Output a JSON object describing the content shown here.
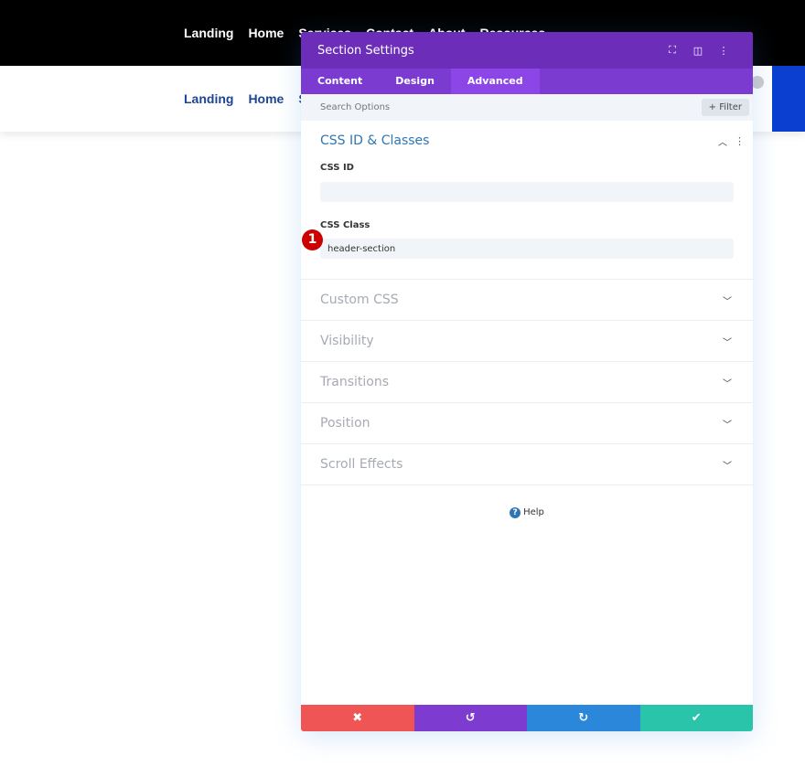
{
  "site_nav": [
    "Landing",
    "Home",
    "Services",
    "Contact",
    "About",
    "Resources"
  ],
  "site_nav_partial": [
    "Landing",
    "Home",
    "Se"
  ],
  "panel": {
    "title": "Section Settings",
    "tabs": [
      "Content",
      "Design",
      "Advanced"
    ],
    "active_tab": "Advanced",
    "search_placeholder": "Search Options",
    "filter_label": "+ Filter",
    "open_section": {
      "title": "CSS ID & Classes",
      "css_id_label": "CSS ID",
      "css_id_value": "",
      "css_class_label": "CSS Class",
      "css_class_value": "header-section"
    },
    "sections": [
      "Custom CSS",
      "Visibility",
      "Transitions",
      "Position",
      "Scroll Effects"
    ],
    "help_label": "Help",
    "footer": {
      "cancel": "✖",
      "undo": "↺",
      "redo": "↻",
      "save": "✔"
    }
  },
  "badge": "1",
  "colors": {
    "header": "#6c2eb9",
    "tabs": "#7b3bd0",
    "cancel": "#ef5555",
    "undo": "#7e3bd0",
    "redo": "#2b87da",
    "save": "#29c4a9"
  }
}
